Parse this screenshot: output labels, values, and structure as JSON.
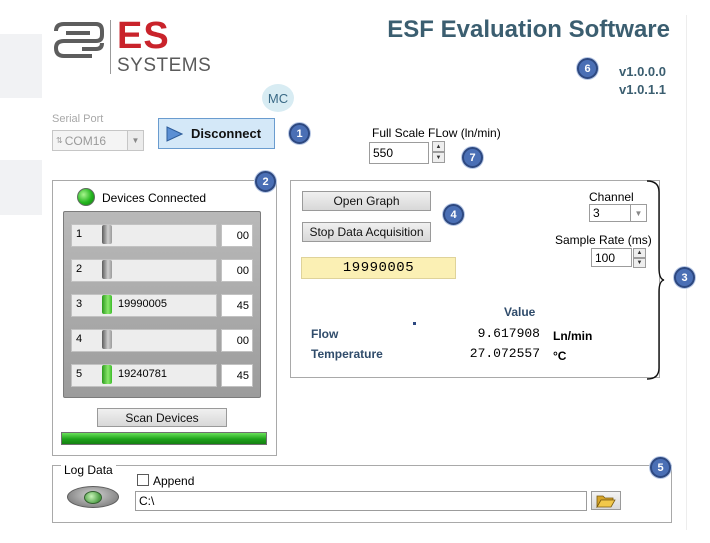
{
  "brand": {
    "logo_letters": "ES",
    "logo_subtitle": "SYSTEMS"
  },
  "app_title": "ESF Evaluation Software",
  "versions": [
    "v1.0.0.0",
    "v1.0.1.1"
  ],
  "mc_label": "MC",
  "badges": [
    "1",
    "2",
    "3",
    "4",
    "5",
    "6",
    "7"
  ],
  "serial_port": {
    "label": "Serial Port",
    "value": "COM16"
  },
  "connect_button": {
    "label": "Disconnect"
  },
  "full_scale": {
    "label": "Full Scale FLow (ln/min)",
    "value": "550"
  },
  "devices": {
    "label": "Devices Connected",
    "rows": [
      {
        "index": "1",
        "serial": "",
        "value": "00",
        "active": false
      },
      {
        "index": "2",
        "serial": "",
        "value": "00",
        "active": false
      },
      {
        "index": "3",
        "serial": "19990005",
        "value": "45",
        "active": true
      },
      {
        "index": "4",
        "serial": "",
        "value": "00",
        "active": false
      },
      {
        "index": "5",
        "serial": "19240781",
        "value": "45",
        "active": true
      }
    ],
    "scan_button": "Scan Devices",
    "scan_progress": 1.0
  },
  "acquisition": {
    "open_graph": "Open Graph",
    "stop_acquisition": "Stop Data Acquisition",
    "selected_serial": "19990005",
    "channel": {
      "label": "Channel",
      "value": "3"
    },
    "sample_rate": {
      "label": "Sample Rate (ms)",
      "value": "100"
    },
    "value_header": "Value",
    "measurements": [
      {
        "name": "Flow",
        "value": "9.617908",
        "unit": "Ln/min"
      },
      {
        "name": "Temperature",
        "value": "27.072557",
        "unit": "°C"
      }
    ]
  },
  "log": {
    "title": "Log Data",
    "append_label": "Append",
    "path": "C:\\"
  },
  "colors": {
    "title": "#3b5e70",
    "brand_red": "#c9232b",
    "badge": "#4a6fb5",
    "led_green": "#23b61e",
    "serial_display_bg": "#fbf0b4"
  },
  "icons": [
    "logo-mark-icon",
    "play-icon",
    "led-icon",
    "folder-open-icon",
    "chevron-down-icon",
    "spin-up-icon",
    "spin-down-icon"
  ]
}
